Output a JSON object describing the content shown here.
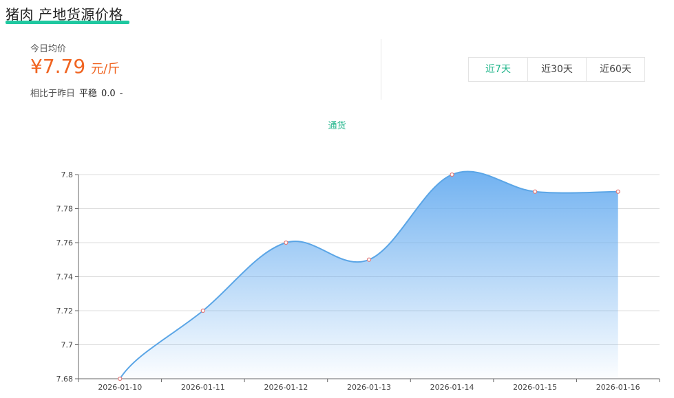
{
  "header": {
    "title": "猪肉 产地货源价格"
  },
  "summary": {
    "label": "今日均价",
    "currency": "¥",
    "price": "7.79",
    "unit": "元/斤",
    "compare_label": "相比于昨日",
    "compare_status": "平稳",
    "compare_value": "0.0",
    "compare_trend": "-"
  },
  "range_tabs": [
    {
      "label": "近7天",
      "active": true
    },
    {
      "label": "近30天",
      "active": false
    },
    {
      "label": "近60天",
      "active": false
    }
  ],
  "colors": {
    "accent": "#1fb58a",
    "price": "#f06421",
    "line": "#5aa5e6",
    "area_top": "#6aaef0",
    "marker": "#e07a7a"
  },
  "chart_data": {
    "type": "area",
    "legend": "通货",
    "x": [
      "2026-01-10",
      "2026-01-11",
      "2026-01-12",
      "2026-01-13",
      "2026-01-14",
      "2026-01-15",
      "2026-01-16"
    ],
    "series": [
      {
        "name": "通货",
        "values": [
          7.68,
          7.72,
          7.76,
          7.75,
          7.8,
          7.79,
          7.79
        ]
      }
    ],
    "ylim": [
      7.68,
      7.8
    ],
    "yticks": [
      7.68,
      7.7,
      7.72,
      7.74,
      7.76,
      7.78,
      7.8
    ],
    "smooth": true,
    "grid": true
  }
}
